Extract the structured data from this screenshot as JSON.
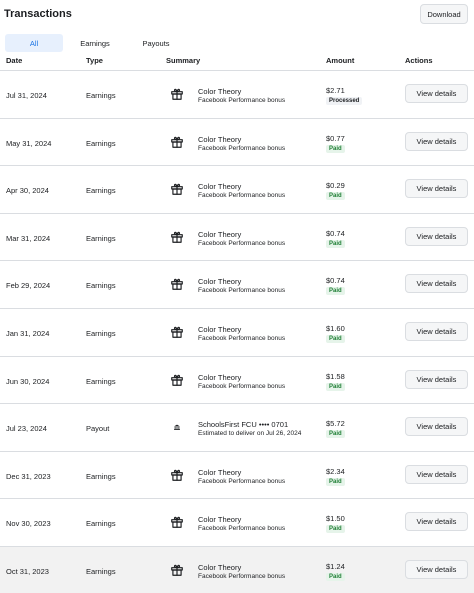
{
  "header": {
    "title": "Transactions",
    "download_label": "Download"
  },
  "tabs": [
    {
      "label": "All",
      "active": true
    },
    {
      "label": "Earnings",
      "active": false
    },
    {
      "label": "Payouts",
      "active": false
    }
  ],
  "columns": {
    "date": "Date",
    "type": "Type",
    "summary": "Summary",
    "amount": "Amount",
    "actions": "Actions"
  },
  "colors": {
    "accent": "#1b74e4",
    "paid": "#1e7e34",
    "paid_bg": "#e6f4ea",
    "border": "#dadde1"
  },
  "rows": [
    {
      "date": "Jul 31, 2024",
      "type": "Earnings",
      "icon": "gift-icon",
      "title": "Color Theory",
      "subtitle": "Facebook Performance bonus",
      "amount": "$2.71",
      "status": "Processed",
      "action": "View details"
    },
    {
      "date": "May 31, 2024",
      "type": "Earnings",
      "icon": "gift-icon",
      "title": "Color Theory",
      "subtitle": "Facebook Performance bonus",
      "amount": "$0.77",
      "status": "Paid",
      "action": "View details"
    },
    {
      "date": "Apr 30, 2024",
      "type": "Earnings",
      "icon": "gift-icon",
      "title": "Color Theory",
      "subtitle": "Facebook Performance bonus",
      "amount": "$0.29",
      "status": "Paid",
      "action": "View details"
    },
    {
      "date": "Mar 31, 2024",
      "type": "Earnings",
      "icon": "gift-icon",
      "title": "Color Theory",
      "subtitle": "Facebook Performance bonus",
      "amount": "$0.74",
      "status": "Paid",
      "action": "View details"
    },
    {
      "date": "Feb 29, 2024",
      "type": "Earnings",
      "icon": "gift-icon",
      "title": "Color Theory",
      "subtitle": "Facebook Performance bonus",
      "amount": "$0.74",
      "status": "Paid",
      "action": "View details"
    },
    {
      "date": "Jan 31, 2024",
      "type": "Earnings",
      "icon": "gift-icon",
      "title": "Color Theory",
      "subtitle": "Facebook Performance bonus",
      "amount": "$1.60",
      "status": "Paid",
      "action": "View details"
    },
    {
      "date": "Jun 30, 2024",
      "type": "Earnings",
      "icon": "gift-icon",
      "title": "Color Theory",
      "subtitle": "Facebook Performance bonus",
      "amount": "$1.58",
      "status": "Paid",
      "action": "View details"
    },
    {
      "date": "Jul 23, 2024",
      "type": "Payout",
      "icon": "bank-icon",
      "title": "SchoolsFirst FCU •••• 0701",
      "subtitle": "Estimated to deliver on Jul 26, 2024",
      "amount": "$5.72",
      "status": "Paid",
      "action": "View details"
    },
    {
      "date": "Dec 31, 2023",
      "type": "Earnings",
      "icon": "gift-icon",
      "title": "Color Theory",
      "subtitle": "Facebook Performance bonus",
      "amount": "$2.34",
      "status": "Paid",
      "action": "View details"
    },
    {
      "date": "Nov 30, 2023",
      "type": "Earnings",
      "icon": "gift-icon",
      "title": "Color Theory",
      "subtitle": "Facebook Performance bonus",
      "amount": "$1.50",
      "status": "Paid",
      "action": "View details"
    },
    {
      "date": "Oct 31, 2023",
      "type": "Earnings",
      "icon": "gift-icon",
      "title": "Color Theory",
      "subtitle": "Facebook Performance bonus",
      "amount": "$1.24",
      "status": "Paid",
      "action": "View details"
    }
  ]
}
